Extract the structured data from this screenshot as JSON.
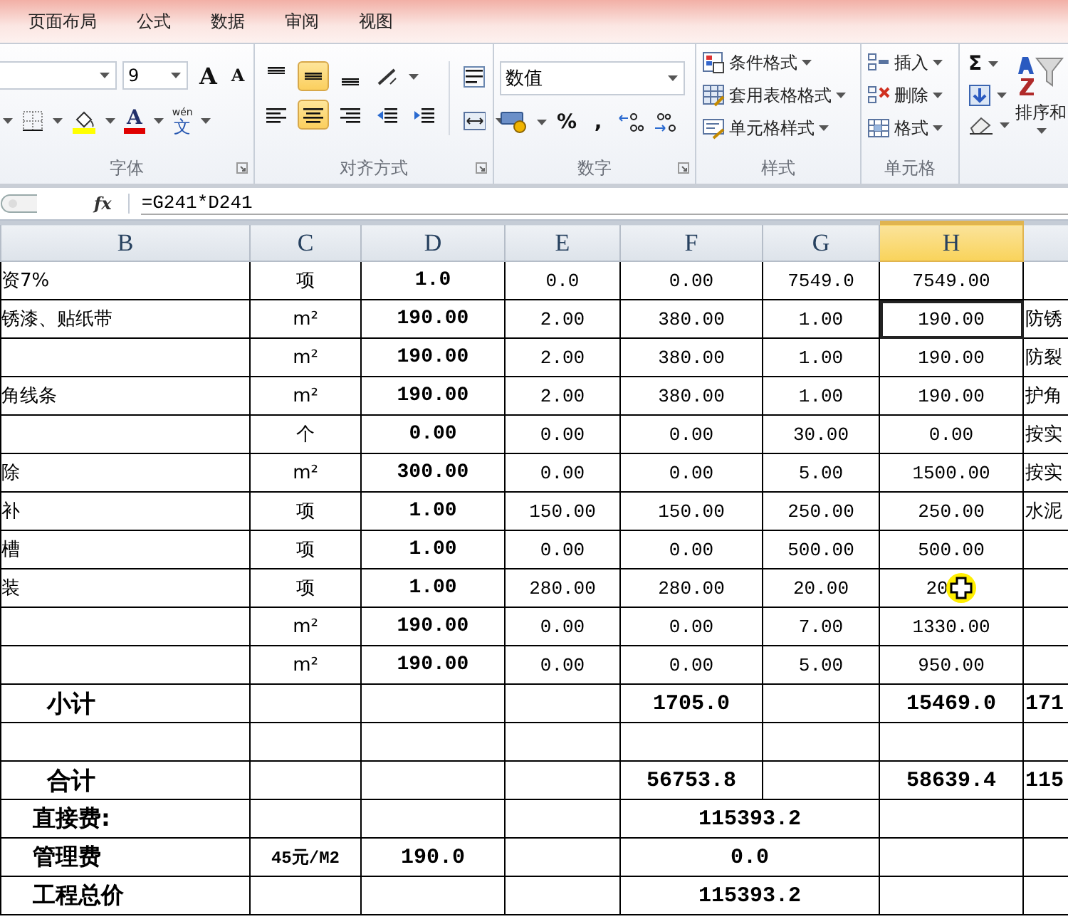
{
  "ribbon": {
    "tabs": [
      {
        "label": "页面布局"
      },
      {
        "label": "公式"
      },
      {
        "label": "数据"
      },
      {
        "label": "审阅"
      },
      {
        "label": "视图"
      }
    ]
  },
  "font_group": {
    "label": "字体",
    "size": "9",
    "grow": "A",
    "shrink": "A",
    "color_glyph": "A",
    "phonetic": "wén",
    "phonetic_char": "文"
  },
  "align_group": {
    "label": "对齐方式",
    "tools": [
      {
        "kind": "top",
        "selected": false
      },
      {
        "kind": "middle",
        "selected": true
      },
      {
        "kind": "bottom",
        "selected": false
      },
      {
        "kind": "orient",
        "selected": false
      },
      {
        "kind": "wrap",
        "selected": false
      },
      {
        "kind": "left",
        "selected": false
      },
      {
        "kind": "center",
        "selected": true
      },
      {
        "kind": "right",
        "selected": false
      },
      {
        "kind": "outdent",
        "selected": false
      },
      {
        "kind": "indent",
        "selected": false
      },
      {
        "kind": "merge",
        "selected": false
      }
    ]
  },
  "number_group": {
    "label": "数字",
    "format": "数值",
    "percent": "%",
    "comma": ","
  },
  "styles_group": {
    "label": "样式",
    "items": [
      {
        "kind": "conditional",
        "label": "条件格式"
      },
      {
        "kind": "table",
        "label": "套用表格格式"
      },
      {
        "kind": "cellstyle",
        "label": "单元格样式"
      }
    ]
  },
  "cells_group": {
    "label": "单元格",
    "items": [
      {
        "kind": "insert",
        "label": "插入"
      },
      {
        "kind": "delete",
        "label": "删除"
      },
      {
        "kind": "format",
        "label": "格式"
      }
    ]
  },
  "editing_group": {
    "sum": "Σ",
    "sort_label": "排序和"
  },
  "formula_bar": {
    "fx": "fx",
    "formula": "=G241*D241"
  },
  "columns": [
    {
      "label": "B",
      "selected": false
    },
    {
      "label": "C",
      "selected": false
    },
    {
      "label": "D",
      "selected": false
    },
    {
      "label": "E",
      "selected": false
    },
    {
      "label": "F",
      "selected": false
    },
    {
      "label": "G",
      "selected": false
    },
    {
      "label": "H",
      "selected": true
    }
  ],
  "rows": [
    {
      "kind": "item",
      "selected": false,
      "hovered": false,
      "B": "资7%",
      "C": "项",
      "D": "1.0",
      "E": "0.0",
      "F": "0.00",
      "G": "7549.0",
      "H": "7549.00"
    },
    {
      "kind": "item",
      "selected": true,
      "hovered": false,
      "B": "锈漆、贴纸带",
      "C": "m²",
      "D": "190.00",
      "E": "2.00",
      "F": "380.00",
      "G": "1.00",
      "H": "190.00",
      "I": "防锈"
    },
    {
      "kind": "item",
      "selected": false,
      "hovered": false,
      "C": "m²",
      "D": "190.00",
      "E": "2.00",
      "F": "380.00",
      "G": "1.00",
      "H": "190.00",
      "I": "防裂"
    },
    {
      "kind": "item",
      "selected": false,
      "hovered": false,
      "B": "角线条",
      "C": "m²",
      "D": "190.00",
      "E": "2.00",
      "F": "380.00",
      "G": "1.00",
      "H": "190.00",
      "I": "护角"
    },
    {
      "kind": "item",
      "selected": false,
      "hovered": false,
      "C": "个",
      "D": "0.00",
      "E": "0.00",
      "F": "0.00",
      "G": "30.00",
      "H": "0.00",
      "I": "按实"
    },
    {
      "kind": "item",
      "selected": false,
      "hovered": false,
      "B": "除",
      "C": "m²",
      "D": "300.00",
      "E": "0.00",
      "F": "0.00",
      "G": "5.00",
      "H": "1500.00",
      "I": "按实"
    },
    {
      "kind": "item",
      "selected": false,
      "hovered": false,
      "B": "补",
      "C": "项",
      "D": "1.00",
      "E": "150.00",
      "F": "150.00",
      "G": "250.00",
      "H": "250.00",
      "I": "水泥"
    },
    {
      "kind": "item",
      "selected": false,
      "hovered": false,
      "B": "槽",
      "C": "项",
      "D": "1.00",
      "E": "0.00",
      "F": "0.00",
      "G": "500.00",
      "H": "500.00"
    },
    {
      "kind": "item",
      "selected": false,
      "hovered": true,
      "B": "装",
      "C": "项",
      "D": "1.00",
      "E": "280.00",
      "F": "280.00",
      "G": "20.00",
      "H": "20"
    },
    {
      "kind": "item",
      "selected": false,
      "hovered": false,
      "C": "m²",
      "D": "190.00",
      "E": "0.00",
      "F": "0.00",
      "G": "7.00",
      "H": "1330.00"
    },
    {
      "kind": "item",
      "selected": false,
      "hovered": false,
      "C": "m²",
      "D": "190.00",
      "E": "0.00",
      "F": "0.00",
      "G": "5.00",
      "H": "950.00"
    },
    {
      "kind": "subtotal",
      "selected": false,
      "hovered": false,
      "B": "小计",
      "F": "1705.0",
      "H": "15469.0",
      "I": "171"
    },
    {
      "kind": "subtotal",
      "selected": false,
      "hovered": false
    },
    {
      "kind": "subtotal",
      "selected": false,
      "hovered": false,
      "B": "合计",
      "F": "56753.8",
      "H": "58639.4",
      "I": "115"
    },
    {
      "kind": "merged",
      "selected": false,
      "hovered": false,
      "B": "直接费:",
      "FG": "115393.2"
    },
    {
      "kind": "merged",
      "selected": false,
      "hovered": false,
      "B": "管理费",
      "C": "45元/M2",
      "D": "190.0",
      "FG": "0.0"
    },
    {
      "kind": "merged",
      "selected": false,
      "hovered": false,
      "B": "工程总价",
      "FG": "115393.2"
    }
  ]
}
